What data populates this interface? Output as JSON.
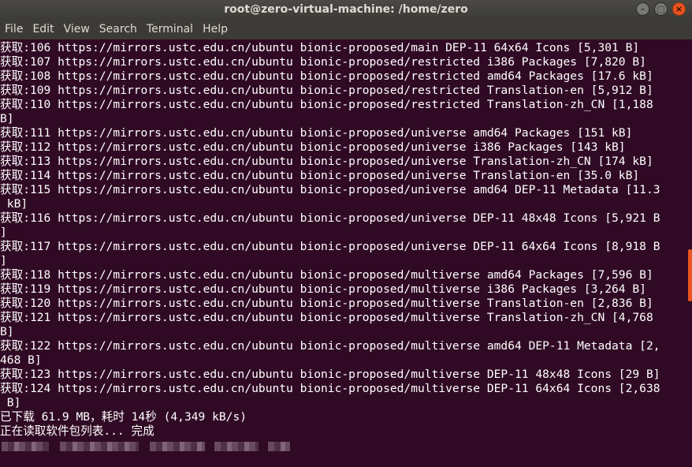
{
  "window": {
    "title": "root@zero-virtual-machine: /home/zero",
    "controls": {
      "minimize": "–",
      "maximize": "□",
      "close": "×"
    }
  },
  "menu": [
    "File",
    "Edit",
    "View",
    "Search",
    "Terminal",
    "Help"
  ],
  "terminal": {
    "lines": [
      "获取:106 https://mirrors.ustc.edu.cn/ubuntu bionic-proposed/main DEP-11 64x64 Icons [5,301 B]",
      "获取:107 https://mirrors.ustc.edu.cn/ubuntu bionic-proposed/restricted i386 Packages [7,820 B]",
      "获取:108 https://mirrors.ustc.edu.cn/ubuntu bionic-proposed/restricted amd64 Packages [17.6 kB]",
      "获取:109 https://mirrors.ustc.edu.cn/ubuntu bionic-proposed/restricted Translation-en [5,912 B]",
      "获取:110 https://mirrors.ustc.edu.cn/ubuntu bionic-proposed/restricted Translation-zh_CN [1,188",
      "B]",
      "获取:111 https://mirrors.ustc.edu.cn/ubuntu bionic-proposed/universe amd64 Packages [151 kB]",
      "获取:112 https://mirrors.ustc.edu.cn/ubuntu bionic-proposed/universe i386 Packages [143 kB]",
      "获取:113 https://mirrors.ustc.edu.cn/ubuntu bionic-proposed/universe Translation-zh_CN [174 kB]",
      "获取:114 https://mirrors.ustc.edu.cn/ubuntu bionic-proposed/universe Translation-en [35.0 kB]",
      "获取:115 https://mirrors.ustc.edu.cn/ubuntu bionic-proposed/universe amd64 DEP-11 Metadata [11.3",
      " kB]",
      "获取:116 https://mirrors.ustc.edu.cn/ubuntu bionic-proposed/universe DEP-11 48x48 Icons [5,921 B",
      "]",
      "获取:117 https://mirrors.ustc.edu.cn/ubuntu bionic-proposed/universe DEP-11 64x64 Icons [8,918 B",
      "]",
      "获取:118 https://mirrors.ustc.edu.cn/ubuntu bionic-proposed/multiverse amd64 Packages [7,596 B]",
      "获取:119 https://mirrors.ustc.edu.cn/ubuntu bionic-proposed/multiverse i386 Packages [3,264 B]",
      "获取:120 https://mirrors.ustc.edu.cn/ubuntu bionic-proposed/multiverse Translation-en [2,836 B]",
      "获取:121 https://mirrors.ustc.edu.cn/ubuntu bionic-proposed/multiverse Translation-zh_CN [4,768",
      "B]",
      "获取:122 https://mirrors.ustc.edu.cn/ubuntu bionic-proposed/multiverse amd64 DEP-11 Metadata [2,",
      "468 B]",
      "获取:123 https://mirrors.ustc.edu.cn/ubuntu bionic-proposed/multiverse DEP-11 48x48 Icons [29 B]",
      "获取:124 https://mirrors.ustc.edu.cn/ubuntu bionic-proposed/multiverse DEP-11 64x64 Icons [2,638",
      " B]",
      "已下载 61.9 MB，耗时 14秒 (4,349 kB/s)",
      "正在读取软件包列表... 完成"
    ]
  },
  "colors": {
    "background": "#300a24",
    "text": "#ffffff",
    "titlebar": "#3c3b37",
    "accent": "#e95420"
  }
}
